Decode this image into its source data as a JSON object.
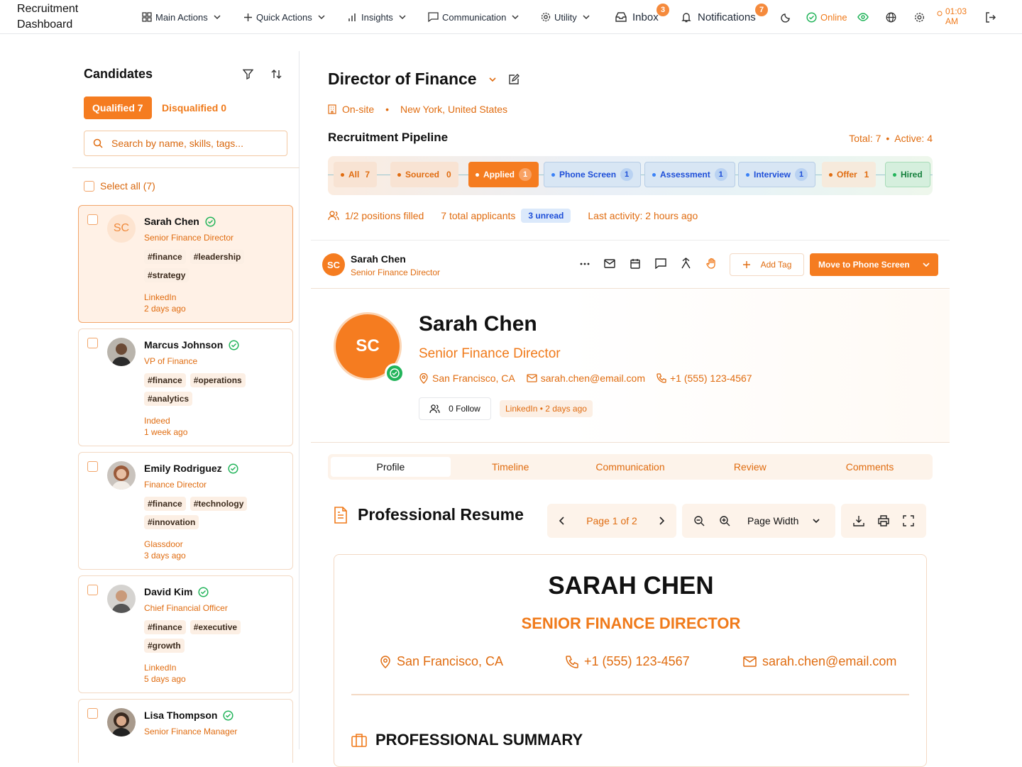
{
  "app": {
    "title": "Recruitment Dashboard"
  },
  "nav": {
    "main_actions": "Main Actions",
    "quick_actions": "Quick Actions",
    "insights": "Insights",
    "communication": "Communication",
    "utility": "Utility",
    "inbox": "Inbox",
    "inbox_count": "3",
    "notifications": "Notifications",
    "notifications_count": "7",
    "status": "Online",
    "time": "01:03",
    "ampm": "AM"
  },
  "candidates": {
    "title": "Candidates",
    "qualified_tab": "Qualified 7",
    "disqualified_tab": "Disqualified 0",
    "search_placeholder": "Search by name, skills, tags...",
    "select_all": "Select all (7)",
    "list": [
      {
        "name": "Sarah Chen",
        "initials": "SC",
        "role": "Senior Finance Director",
        "tags": [
          "#finance",
          "#leadership",
          "#strategy"
        ],
        "source": "LinkedIn",
        "time": "2 days ago"
      },
      {
        "name": "Marcus Johnson",
        "role": "VP of Finance",
        "tags": [
          "#finance",
          "#operations",
          "#analytics"
        ],
        "source": "Indeed",
        "time": "1 week ago"
      },
      {
        "name": "Emily Rodriguez",
        "role": "Finance Director",
        "tags": [
          "#finance",
          "#technology",
          "#innovation"
        ],
        "source": "Glassdoor",
        "time": "3 days ago"
      },
      {
        "name": "David Kim",
        "role": "Chief Financial Officer",
        "tags": [
          "#finance",
          "#executive",
          "#growth"
        ],
        "source": "LinkedIn",
        "time": "5 days ago"
      },
      {
        "name": "Lisa Thompson",
        "role": "Senior Finance Manager"
      }
    ]
  },
  "job": {
    "title": "Director of Finance",
    "location_type": "On-site",
    "location": "New York, United States"
  },
  "pipeline": {
    "title": "Recruitment Pipeline",
    "total": "Total: 7",
    "active": "Active: 4",
    "stages": [
      {
        "label": "All",
        "count": "7"
      },
      {
        "label": "Sourced",
        "count": "0"
      },
      {
        "label": "Applied",
        "count": "1"
      },
      {
        "label": "Phone Screen",
        "count": "1"
      },
      {
        "label": "Assessment",
        "count": "1"
      },
      {
        "label": "Interview",
        "count": "1"
      },
      {
        "label": "Offer",
        "count": "1"
      },
      {
        "label": "Hired"
      }
    ],
    "positions_filled": "1/2 positions filled",
    "total_applicants": "7 total applicants",
    "unread": "3 unread",
    "last_activity": "Last activity: 2 hours ago"
  },
  "selected": {
    "name": "Sarah Chen",
    "initials": "SC",
    "role": "Senior Finance Director",
    "location": "San Francisco, CA",
    "email": "sarah.chen@email.com",
    "phone": "+1 (555) 123-4567",
    "follow": "0 Follow",
    "source_badge": "LinkedIn • 2 days ago",
    "add_tag": "Add Tag",
    "move_button": "Move to Phone Screen"
  },
  "tabs": [
    "Profile",
    "Timeline",
    "Communication",
    "Review",
    "Comments"
  ],
  "resume": {
    "title": "Professional Resume",
    "page": "Page 1 of 2",
    "zoom": "Page Width",
    "name": "SARAH CHEN",
    "role": "SENIOR FINANCE DIRECTOR",
    "location": "San Francisco, CA",
    "phone": "+1 (555) 123-4567",
    "email": "sarah.chen@email.com",
    "section": "PROFESSIONAL SUMMARY"
  },
  "colors": {
    "accent": "#f57c20",
    "success": "#22b45a",
    "info": "#1d4ed8"
  }
}
